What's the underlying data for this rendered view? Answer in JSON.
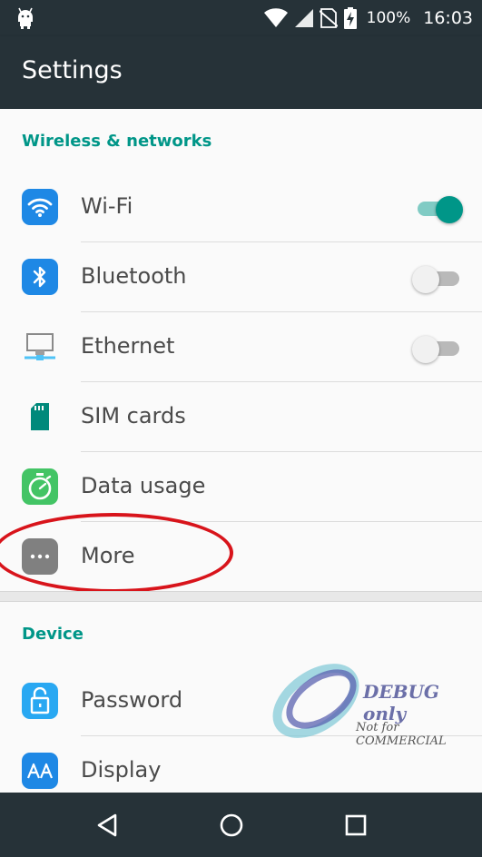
{
  "status_bar": {
    "battery_percent": "100%",
    "time": "16:03",
    "icons": [
      "android-debug-icon",
      "wifi-signal-icon",
      "cell-signal-icon",
      "no-sim-icon",
      "battery-charging-icon"
    ]
  },
  "app_bar": {
    "title": "Settings"
  },
  "sections": {
    "wireless": {
      "header": "Wireless & networks",
      "items": [
        {
          "label": "Wi-Fi",
          "icon": "wifi-icon",
          "toggle": true
        },
        {
          "label": "Bluetooth",
          "icon": "bluetooth-icon",
          "toggle": false
        },
        {
          "label": "Ethernet",
          "icon": "ethernet-icon",
          "toggle": false
        },
        {
          "label": "SIM cards",
          "icon": "sim-card-icon"
        },
        {
          "label": "Data usage",
          "icon": "data-usage-icon"
        },
        {
          "label": "More",
          "icon": "more-icon"
        }
      ]
    },
    "device": {
      "header": "Device",
      "items": [
        {
          "label": "Password",
          "icon": "lock-icon"
        },
        {
          "label": "Display",
          "icon": "display-icon"
        }
      ]
    }
  },
  "watermark": {
    "line1": "DEBUG only",
    "line2": "Not for COMMERCIAL"
  },
  "nav_bar": {
    "buttons": [
      "back-icon",
      "home-icon",
      "recents-icon"
    ]
  },
  "colors": {
    "bar_bg": "#263238",
    "accent": "#009688",
    "highlight": "#d8141b"
  }
}
